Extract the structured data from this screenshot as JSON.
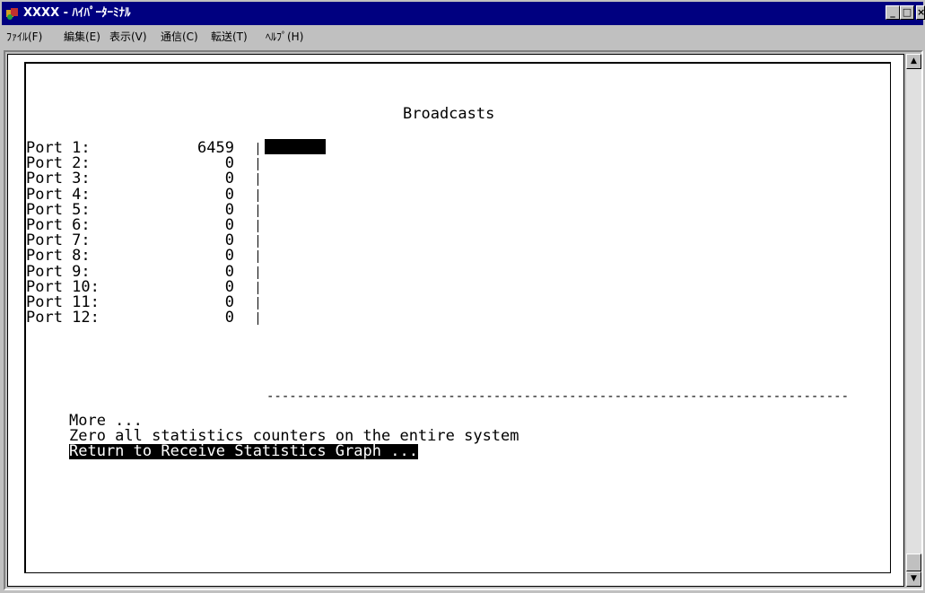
{
  "window": {
    "title": "XXXX - ﾊｲﾊﾟｰﾀｰﾐﾅﾙ",
    "controls": [
      "_",
      "□",
      "×"
    ]
  },
  "menubar": {
    "items": [
      {
        "label": "ﾌｧｲﾙ(F)"
      },
      {
        "label": "編集(E)"
      },
      {
        "label": "表示(V)"
      },
      {
        "label": "通信(C)"
      },
      {
        "label": "転送(T)"
      },
      {
        "label": "ﾍﾙﾌﾟ(H)"
      }
    ]
  },
  "terminal": {
    "heading": "Broadcasts",
    "ports": [
      {
        "label": "Port 1:",
        "value": "6459",
        "bar": 0.1
      },
      {
        "label": "Port 2:",
        "value": "0",
        "bar": 0
      },
      {
        "label": "Port 3:",
        "value": "0",
        "bar": 0
      },
      {
        "label": "Port 4:",
        "value": "0",
        "bar": 0
      },
      {
        "label": "Port 5:",
        "value": "0",
        "bar": 0
      },
      {
        "label": "Port 6:",
        "value": "0",
        "bar": 0
      },
      {
        "label": "Port 7:",
        "value": "0",
        "bar": 0
      },
      {
        "label": "Port 8:",
        "value": "0",
        "bar": 0
      },
      {
        "label": "Port 9:",
        "value": "0",
        "bar": 0
      },
      {
        "label": "Port 10:",
        "value": "0",
        "bar": 0
      },
      {
        "label": "Port 11:",
        "value": "0",
        "bar": 0
      },
      {
        "label": "Port 12:",
        "value": "0",
        "bar": 0
      }
    ],
    "separator": "-----------------------------------------------------------------------------",
    "menu": {
      "more": "More ...",
      "zero": "Zero all statistics counters on the entire system",
      "return": "Return to Receive Statistics Graph ..."
    }
  },
  "scrollbar": {
    "up": "▲",
    "down": "▼"
  }
}
